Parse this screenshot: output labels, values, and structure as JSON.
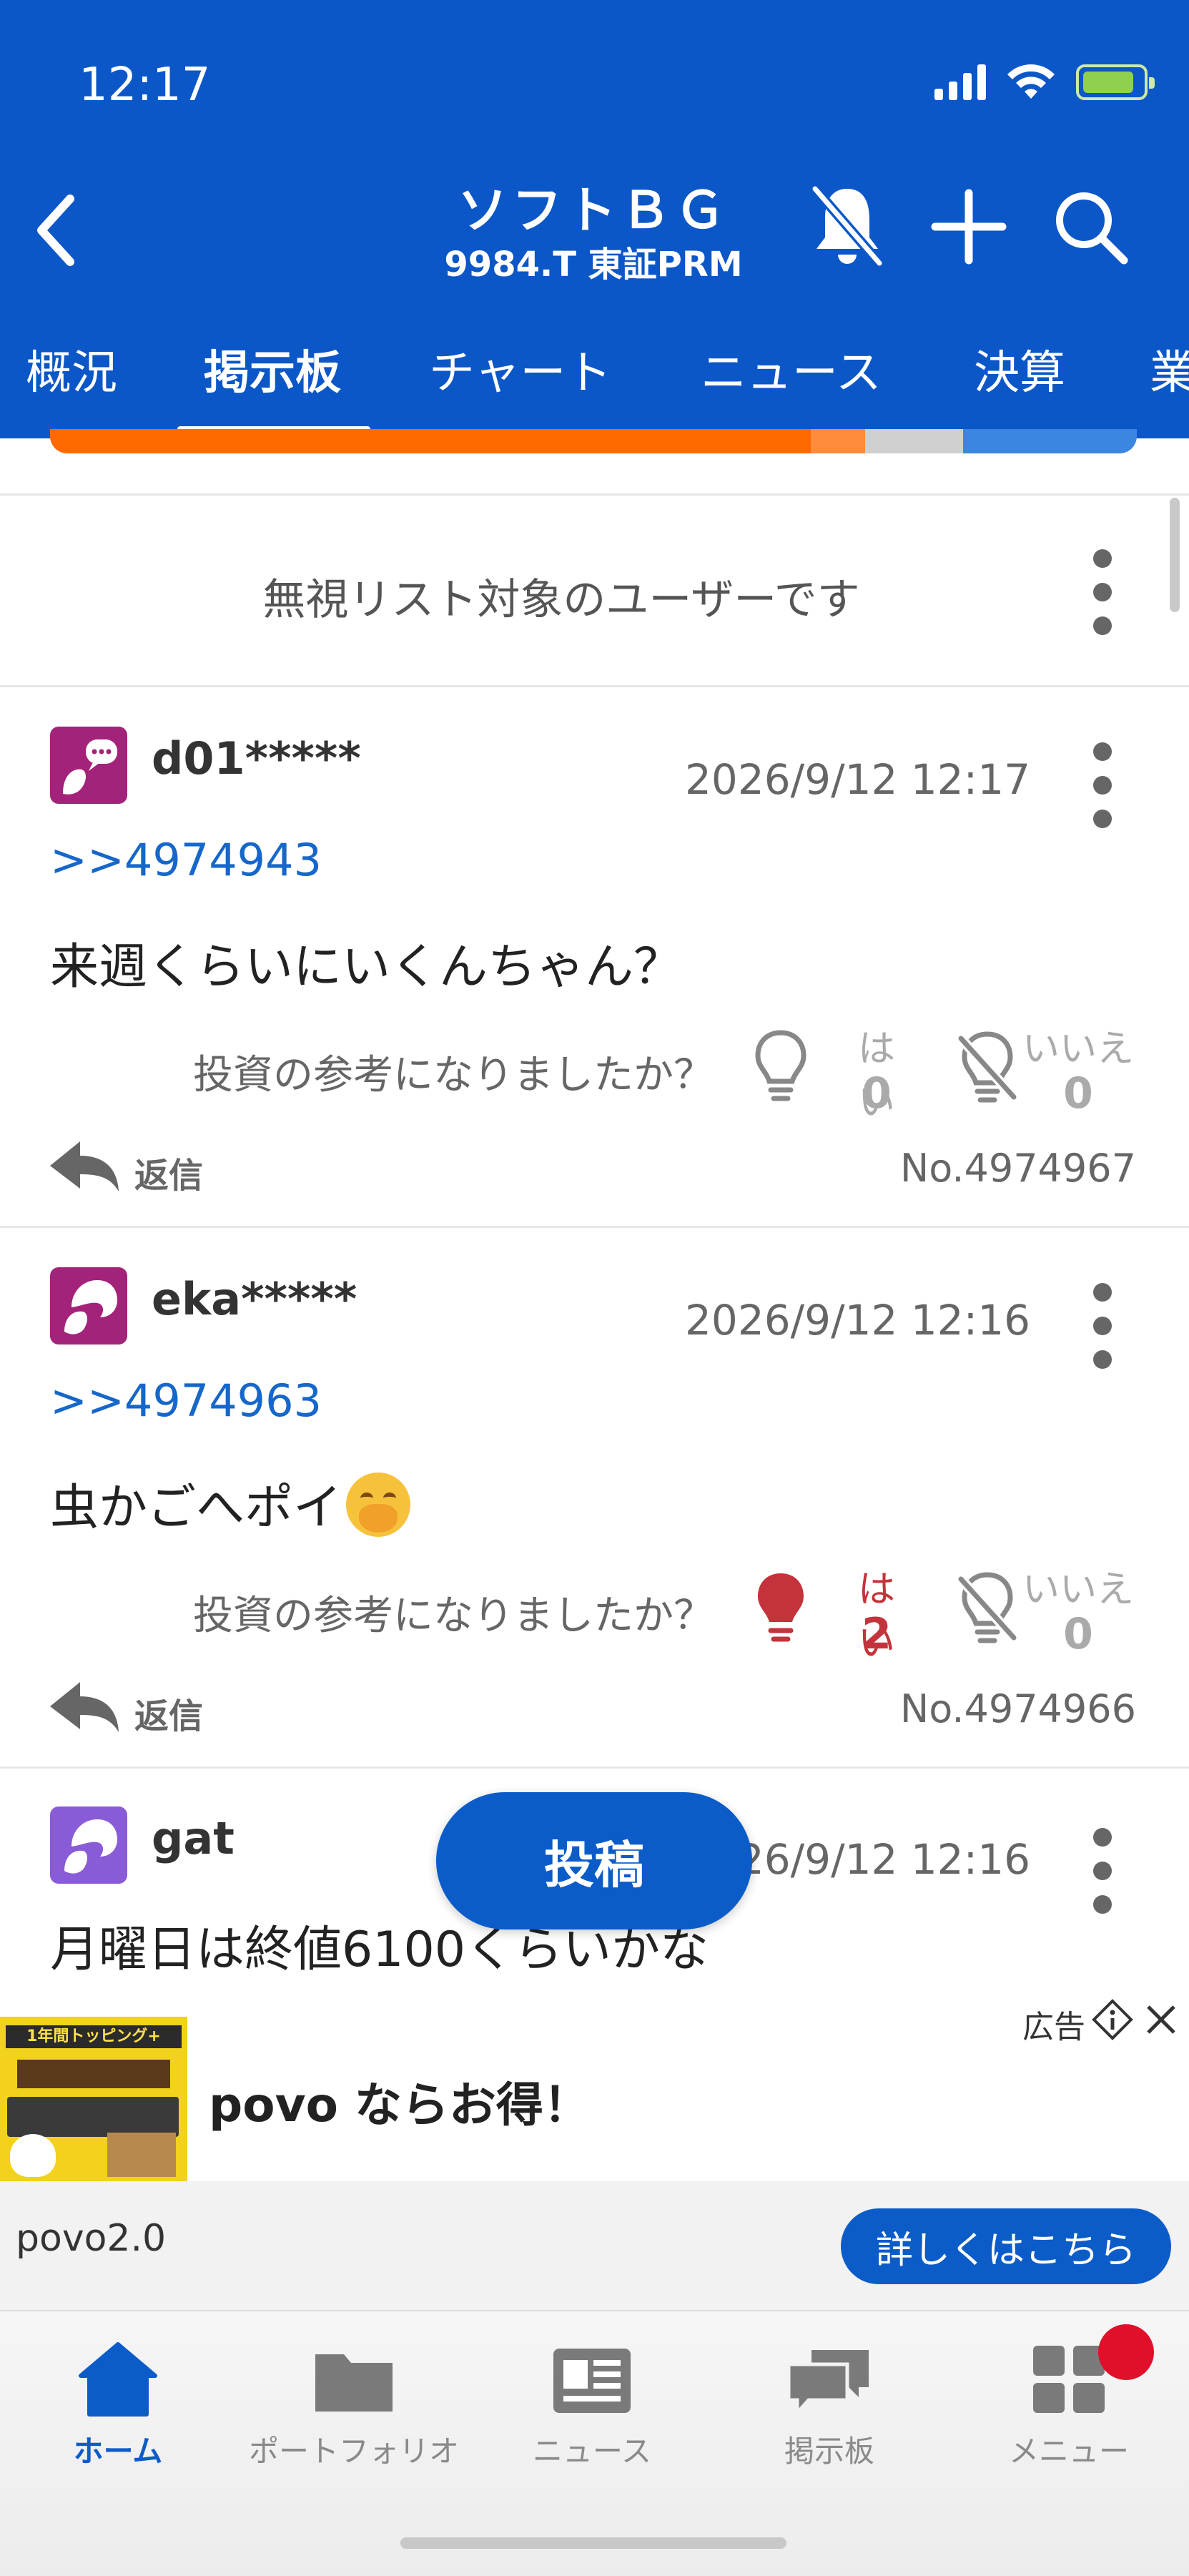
{
  "status_bar": {
    "time": "12:17"
  },
  "header": {
    "title": "ソフトＢＧ",
    "subtitle": "9984.T 東証PRM"
  },
  "tabs": [
    {
      "label": "概況",
      "active": false
    },
    {
      "label": "掲示板",
      "active": true
    },
    {
      "label": "チャート",
      "active": false
    },
    {
      "label": "ニュース",
      "active": false
    },
    {
      "label": "決算",
      "active": false
    },
    {
      "label": "業",
      "active": false
    }
  ],
  "sentiment": {
    "segments_percent": [
      70,
      5,
      9,
      16
    ],
    "colors": [
      "#ff6a00",
      "#ff8c3a",
      "#d0d0d0",
      "#3a86e0"
    ]
  },
  "ignored_post": {
    "text": "無視リスト対象のユーザーです"
  },
  "posts": [
    {
      "username": "d01*****",
      "date": "2026/9/12 12:17",
      "reply_to": ">>4974943",
      "body": "来週くらいにいくんちゃん？",
      "vote_question": "投資の参考になりましたか？",
      "yes_label": "はい",
      "yes_count": "0",
      "no_label": "いいえ",
      "no_count": "0",
      "reply_label": "返信",
      "post_number": "No.4974967",
      "avatar_color": "#a3237a"
    },
    {
      "username": "eka*****",
      "date": "2026/9/12 12:16",
      "reply_to": ">>4974963",
      "body": "虫かごへポイ",
      "vote_question": "投資の参考になりましたか？",
      "yes_label": "はい",
      "yes_count": "2",
      "no_label": "いいえ",
      "no_count": "0",
      "reply_label": "返信",
      "post_number": "No.4974966",
      "avatar_color": "#a3237a"
    },
    {
      "username": "gat",
      "date": "2026/9/12 12:16",
      "body": "月曜日は終値6100くらいかな",
      "avatar_color": "#8a5bd6"
    }
  ],
  "post_button": {
    "label": "投稿"
  },
  "ad": {
    "label": "広告",
    "image_text": "1年間トッピング+",
    "title": "povo ならお得！",
    "advertiser": "povo2.0",
    "cta": "詳しくはこちら"
  },
  "bottom_nav": [
    {
      "label": "ホーム",
      "icon": "home-icon",
      "active": true
    },
    {
      "label": "ポートフォリオ",
      "icon": "folder-icon",
      "active": false
    },
    {
      "label": "ニュース",
      "icon": "newspaper-icon",
      "active": false
    },
    {
      "label": "掲示板",
      "icon": "chat-bubbles-icon",
      "active": false
    },
    {
      "label": "メニュー",
      "icon": "grid-menu-icon",
      "active": false
    }
  ]
}
